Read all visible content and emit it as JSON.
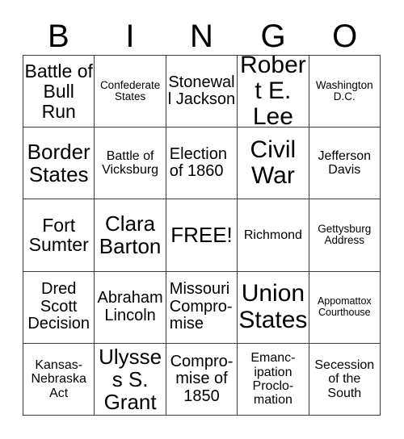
{
  "card": {
    "header": {
      "letters": [
        "B",
        "I",
        "N",
        "G",
        "O"
      ]
    },
    "grid": {
      "columns": 5,
      "rows": 5,
      "free_space_index": 12,
      "cells": [
        {
          "text": "Battle of Bull Run",
          "size": "lg",
          "align": "center"
        },
        {
          "text": "Confederate States",
          "size": "xs",
          "align": "center"
        },
        {
          "text": "Stonewall Jackson",
          "size": "md",
          "align": "center"
        },
        {
          "text": "Robert E. Lee",
          "size": "xxl",
          "align": "center"
        },
        {
          "text": "Washington D.C.",
          "size": "xs",
          "align": "center"
        },
        {
          "text": "Border States",
          "size": "xl",
          "align": "center"
        },
        {
          "text": "Battle of Vicksburg",
          "size": "sm",
          "align": "center"
        },
        {
          "text": "Election of 1860",
          "size": "md",
          "align": "left"
        },
        {
          "text": "Civil War",
          "size": "xxl",
          "align": "center"
        },
        {
          "text": "Jefferson Davis",
          "size": "sm",
          "align": "center"
        },
        {
          "text": "Fort Sumter",
          "size": "lg",
          "align": "center"
        },
        {
          "text": "Clara Barton",
          "size": "xl",
          "align": "center"
        },
        {
          "text": "FREE!",
          "size": "xl",
          "align": "center"
        },
        {
          "text": "Richmond",
          "size": "sm",
          "align": "center"
        },
        {
          "text": "Gettysburg Address",
          "size": "xs",
          "align": "center"
        },
        {
          "text": "Dred Scott Decision",
          "size": "md",
          "align": "center"
        },
        {
          "text": "Abraham Lincoln",
          "size": "md",
          "align": "center"
        },
        {
          "text": "Missouri Compro- mise",
          "size": "md",
          "align": "left"
        },
        {
          "text": "Union States",
          "size": "xxl",
          "align": "center"
        },
        {
          "text": "Appomattox Courthouse",
          "size": "xxs",
          "align": "center"
        },
        {
          "text": "Kansas- Nebraska Act",
          "size": "sm",
          "align": "center"
        },
        {
          "text": "Ulysses S. Grant",
          "size": "xl",
          "align": "center"
        },
        {
          "text": "Compro- mise of 1850",
          "size": "md",
          "align": "center"
        },
        {
          "text": "Emanc- ipation Proclo- mation",
          "size": "sm",
          "align": "center"
        },
        {
          "text": "Secession of the South",
          "size": "sm",
          "align": "center"
        }
      ]
    }
  }
}
